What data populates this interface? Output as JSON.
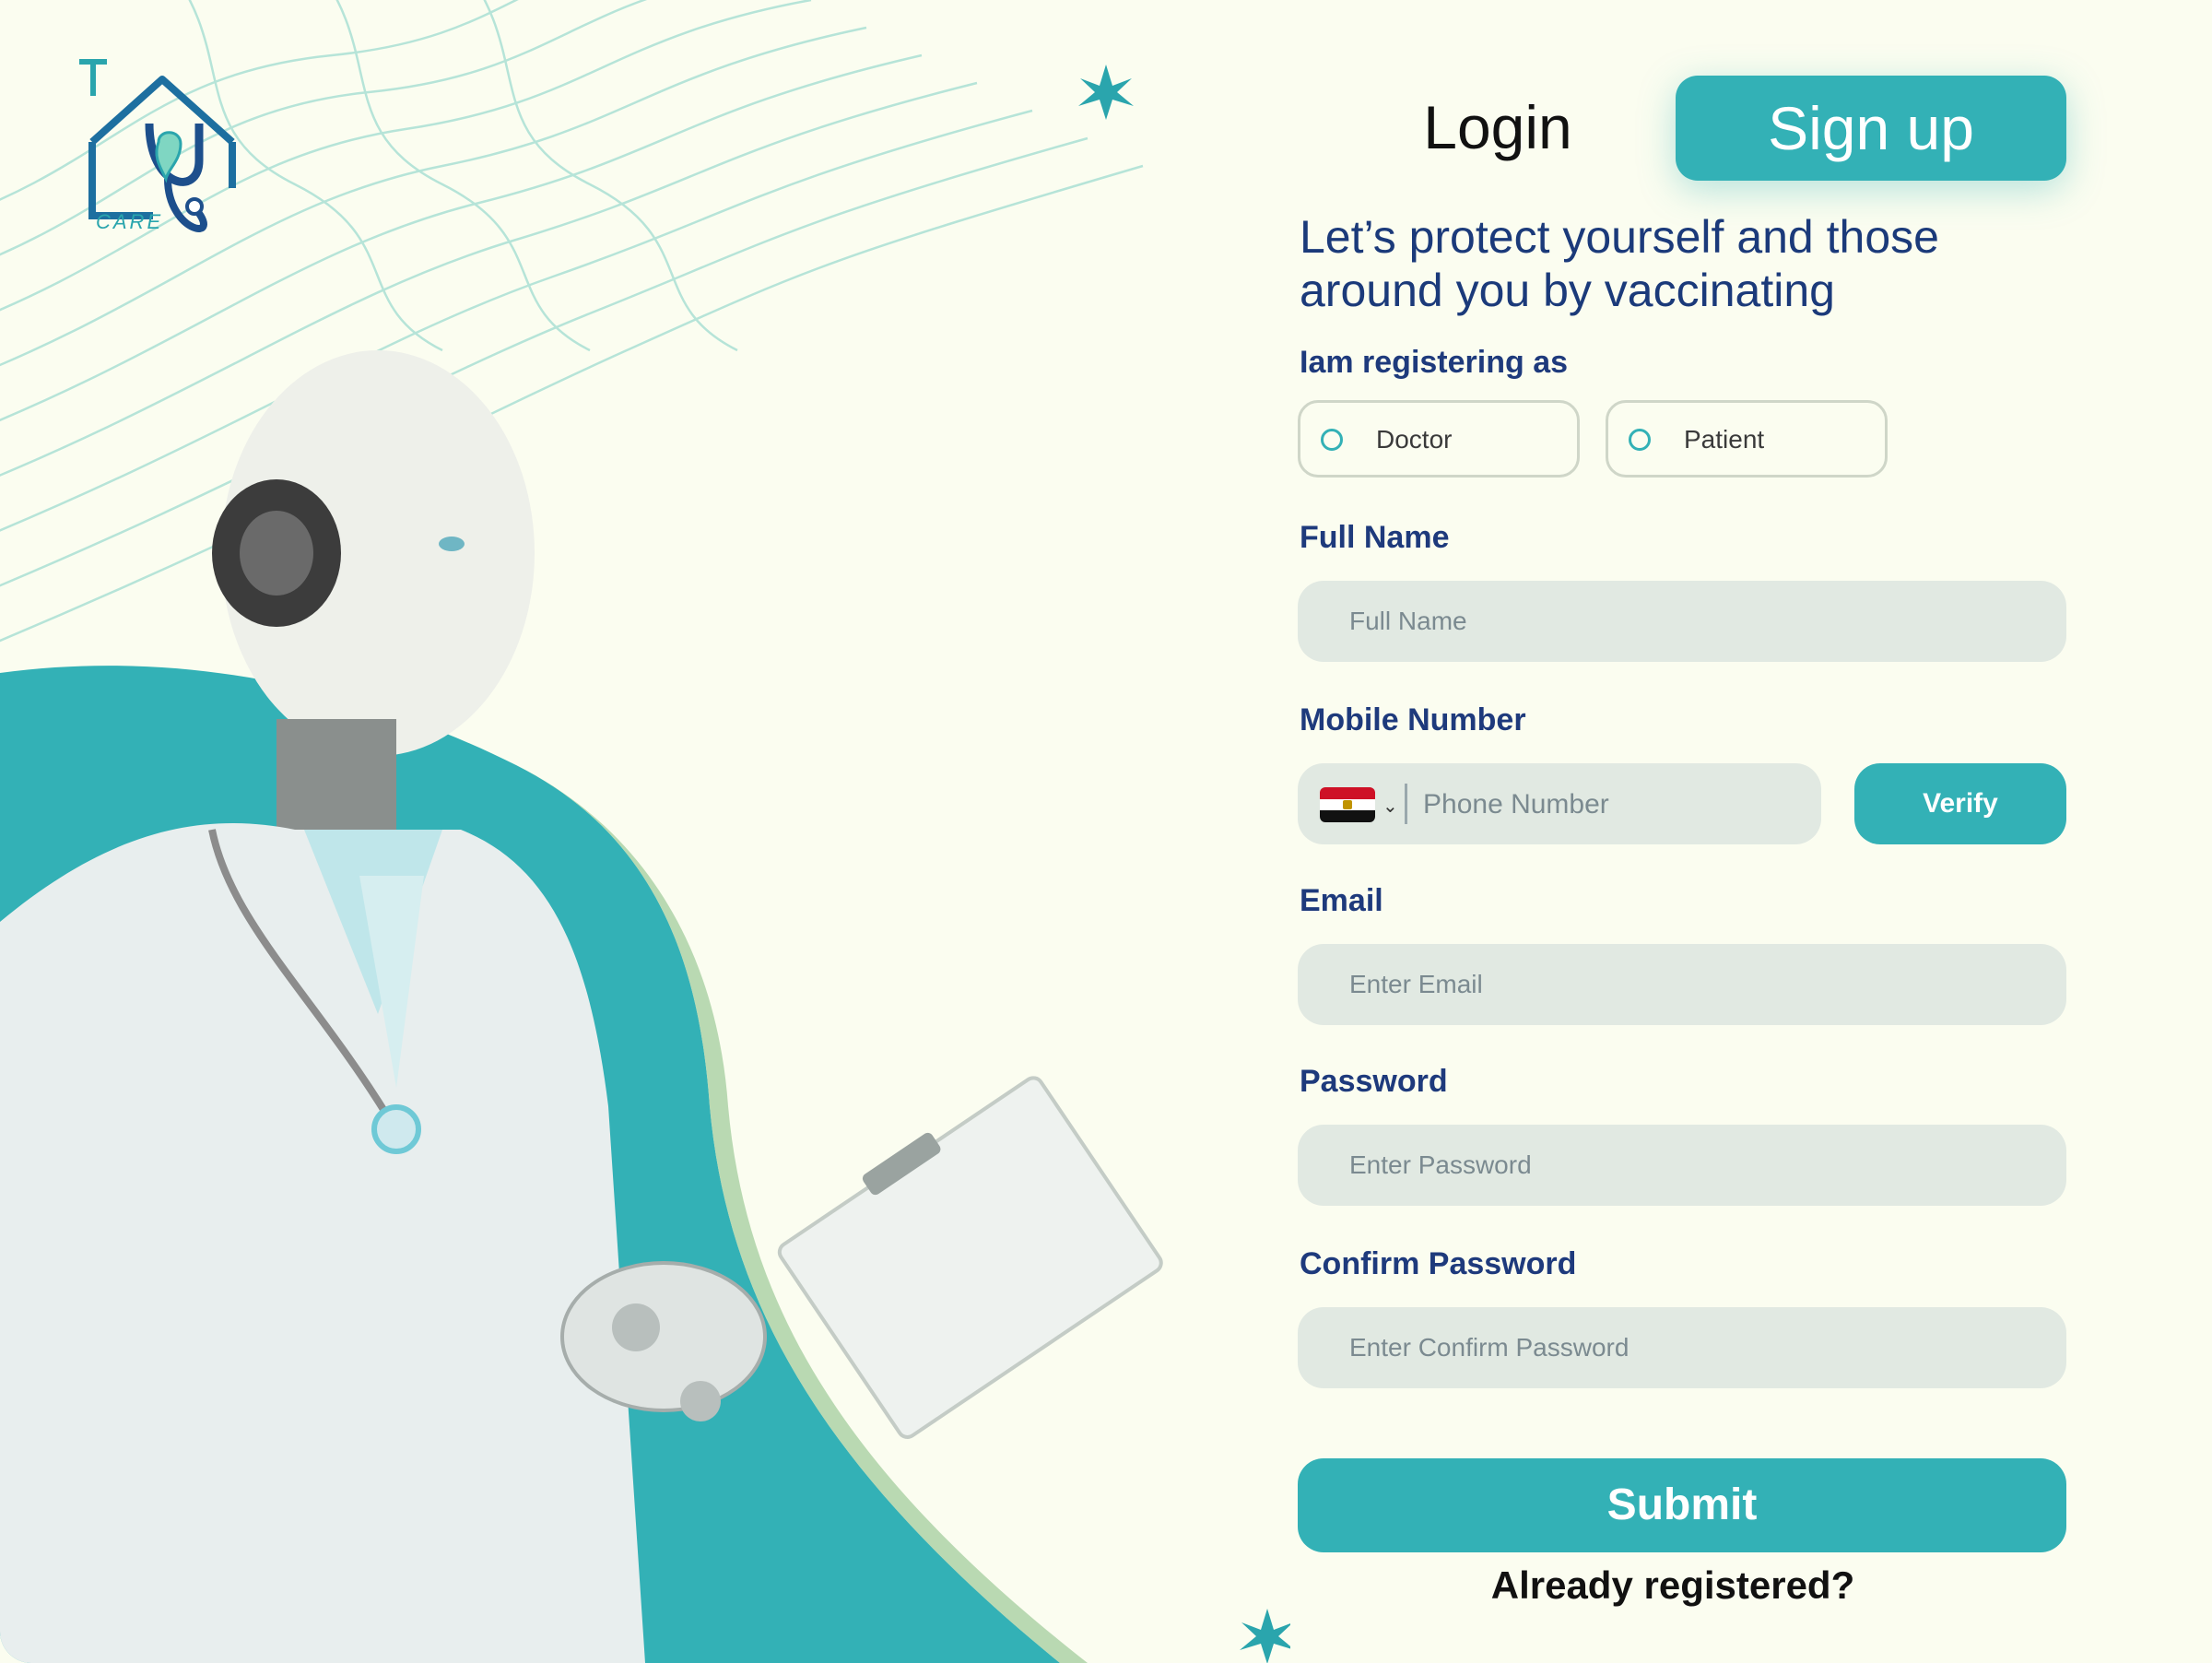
{
  "brand": {
    "logo_text": "CARE"
  },
  "tabs": {
    "login": "Login",
    "signup": "Sign up"
  },
  "headline": "Let’s protect yourself and those around you by vaccinating",
  "role": {
    "label": "Iam registering as",
    "options": [
      "Doctor",
      "Patient"
    ]
  },
  "full_name": {
    "label": "Full Name",
    "placeholder": "Full Name"
  },
  "mobile": {
    "label": "Mobile Number",
    "placeholder": "Phone Number",
    "verify_label": "Verify"
  },
  "email": {
    "label": "Email",
    "placeholder": "Enter Email"
  },
  "password": {
    "label": "Password",
    "placeholder": "Enter Password"
  },
  "confirm_password": {
    "label": "Confirm Password",
    "placeholder": "Enter Confirm Password"
  },
  "submit_label": "Submit",
  "already_registered": "Already registered?",
  "colors": {
    "accent": "#33b1b6",
    "navy": "#1e3a7c",
    "background": "#fbfdf0",
    "input": "#e1e9e2"
  }
}
